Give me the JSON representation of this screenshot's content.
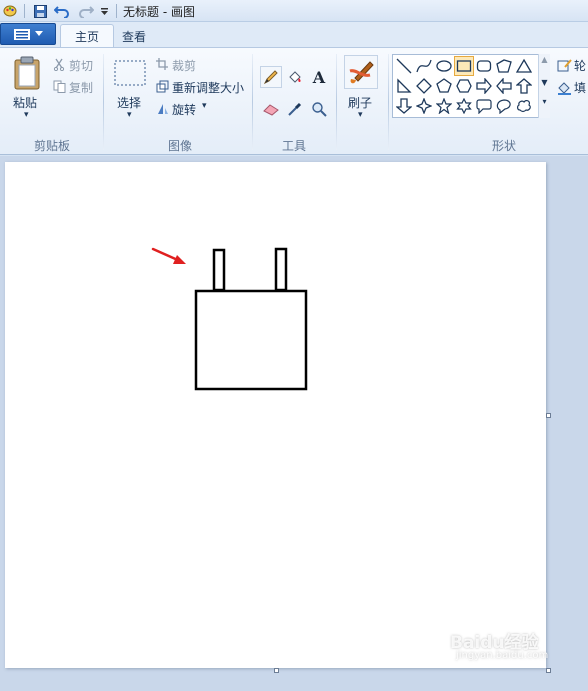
{
  "window": {
    "title": "无标题 - 画图"
  },
  "quick_access": {
    "icons": [
      "paint-app-icon",
      "save-icon",
      "undo-icon",
      "redo-icon",
      "customize-dropdown-icon"
    ]
  },
  "tabs": [
    {
      "label": "主页",
      "active": true
    },
    {
      "label": "查看",
      "active": false
    }
  ],
  "ribbon": {
    "clipboard": {
      "paste_label": "粘贴",
      "cut_label": "剪切",
      "copy_label": "复制",
      "group_label": "剪贴板"
    },
    "image": {
      "select_label": "选择",
      "crop_label": "裁剪",
      "resize_label": "重新调整大小",
      "rotate_label": "旋转",
      "group_label": "图像"
    },
    "tools": {
      "group_label": "工具",
      "items": [
        "pencil-icon",
        "fill-icon",
        "text-icon",
        "eraser-icon",
        "color-picker-icon",
        "magnifier-icon"
      ],
      "text_glyph": "A"
    },
    "brushes": {
      "label": "刷子"
    },
    "shapes": {
      "group_label": "形状",
      "selected": "rectangle",
      "outline_label": "轮",
      "fill_label": "填"
    }
  },
  "watermark": {
    "text": "Baidu经验",
    "url": "jingyan.baidu.com"
  },
  "colors": {
    "accent": "#1f5bb1",
    "annotation_arrow": "#e02020",
    "selected_shape": "#fde9b8"
  }
}
